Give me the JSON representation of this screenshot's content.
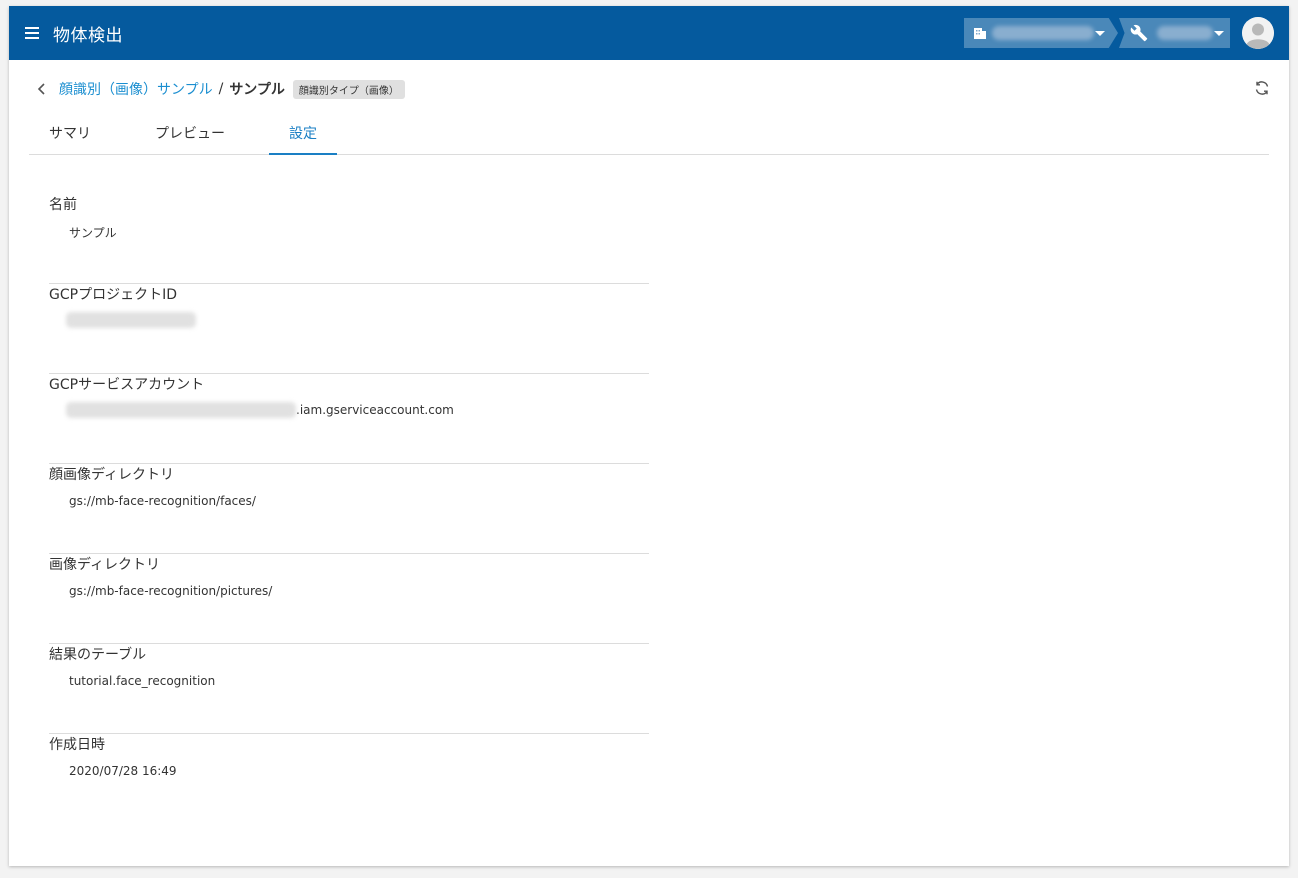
{
  "app": {
    "title": "物体検出"
  },
  "header": {
    "org_icon": "building-icon",
    "project_icon": "wrench-icon",
    "avatar_icon": "user-avatar-icon"
  },
  "breadcrumb": {
    "parent": "顔識別（画像）サンプル",
    "separator": "/",
    "current": "サンプル",
    "badge": "顔識別タイプ（画像）"
  },
  "tabs": [
    {
      "label": "サマリ"
    },
    {
      "label": "プレビュー"
    },
    {
      "label": "設定",
      "active": true
    }
  ],
  "settings": {
    "name": {
      "label": "名前",
      "value": "サンプル"
    },
    "gcp_project_id": {
      "label": "GCPプロジェクトID"
    },
    "gcp_service_account": {
      "label": "GCPサービスアカウント",
      "suffix": ".iam.gserviceaccount.com"
    },
    "face_image_dir": {
      "label": "顔画像ディレクトリ",
      "value": "gs://mb-face-recognition/faces/"
    },
    "image_dir": {
      "label": "画像ディレクトリ",
      "value": "gs://mb-face-recognition/pictures/"
    },
    "result_table": {
      "label": "結果のテーブル",
      "value": "tutorial.face_recognition"
    },
    "created_at": {
      "label": "作成日時",
      "value": "2020/07/28 16:49"
    }
  },
  "colors": {
    "appbar": "#055a9e",
    "link": "#1a8ed0",
    "active_tab": "#1a7fc4"
  }
}
